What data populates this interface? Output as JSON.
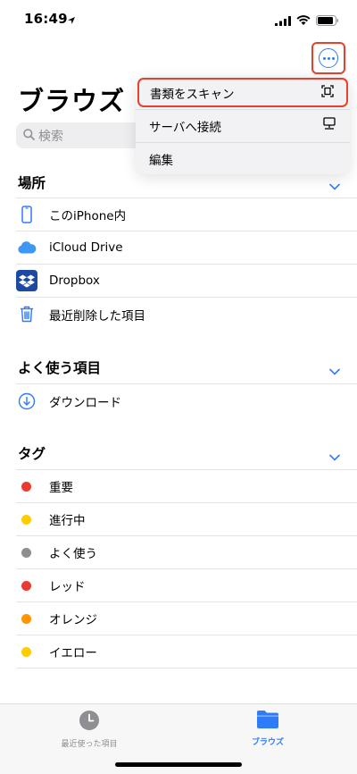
{
  "status_bar": {
    "time": "16:49"
  },
  "header": {
    "title": "ブラウズ"
  },
  "search": {
    "placeholder": "検索"
  },
  "popup_menu": {
    "items": [
      {
        "label": "書類をスキャン",
        "icon": "scan-icon"
      },
      {
        "label": "サーバへ接続",
        "icon": "server-icon"
      },
      {
        "label": "編集"
      }
    ]
  },
  "locations": {
    "header": "場所",
    "items": [
      {
        "label": "このiPhone内",
        "icon": "iphone-icon"
      },
      {
        "label": "iCloud Drive",
        "icon": "icloud-icon"
      },
      {
        "label": "Dropbox",
        "icon": "dropbox-icon"
      },
      {
        "label": "最近削除した項目",
        "icon": "trash-icon"
      }
    ]
  },
  "favorites": {
    "header": "よく使う項目",
    "items": [
      {
        "label": "ダウンロード",
        "icon": "download-icon"
      }
    ]
  },
  "tags": {
    "header": "タグ",
    "items": [
      {
        "label": "重要",
        "color": "#eb3b30"
      },
      {
        "label": "進行中",
        "color": "#ffcc00"
      },
      {
        "label": "よく使う",
        "color": "#8e8e93"
      },
      {
        "label": "レッド",
        "color": "#eb3b30"
      },
      {
        "label": "オレンジ",
        "color": "#ff9500"
      },
      {
        "label": "イエロー",
        "color": "#ffcc00"
      }
    ]
  },
  "tabbar": {
    "tabs": [
      {
        "label": "最近使った項目",
        "icon": "clock-icon",
        "active": false
      },
      {
        "label": "ブラウズ",
        "icon": "folder-icon",
        "active": true
      }
    ]
  },
  "colors": {
    "accent": "#2f7cf6",
    "highlight": "#e8412b"
  }
}
